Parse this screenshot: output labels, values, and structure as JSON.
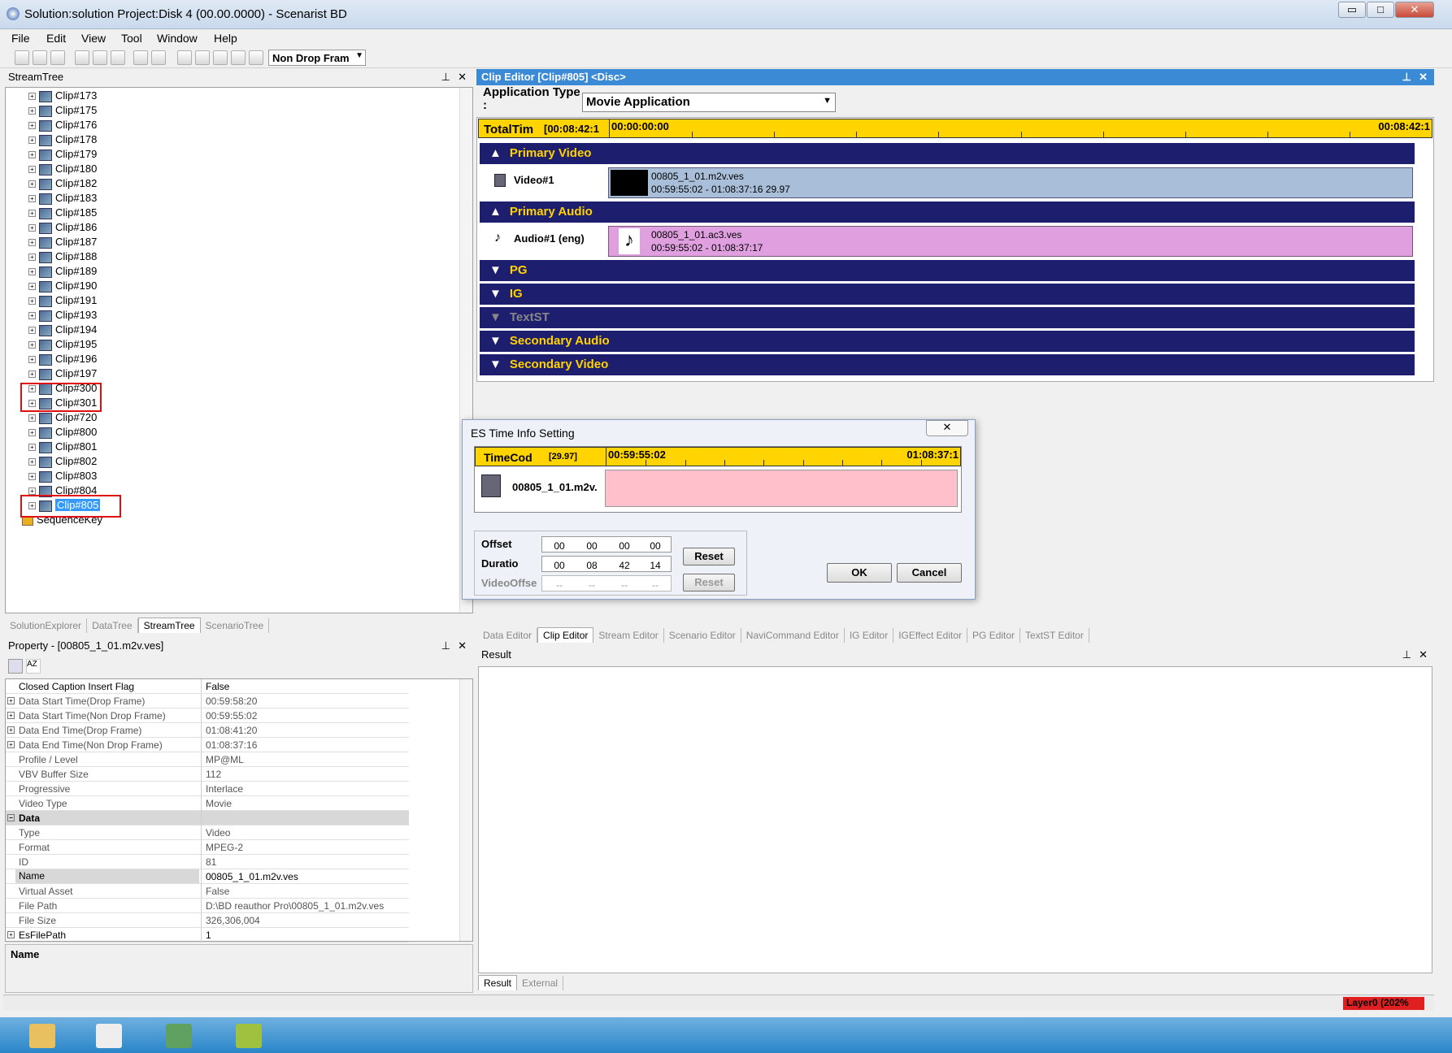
{
  "window": {
    "title": "Solution:solution  Project:Disk 4 (00.00.0000) - Scenarist BD",
    "min": "▭",
    "max": "□",
    "close": "✕"
  },
  "menu": [
    "File",
    "Edit",
    "View",
    "Tool",
    "Window",
    "Help"
  ],
  "toolbar": {
    "timecode_mode": "Non Drop Fram"
  },
  "stream_tree": {
    "header": "StreamTree",
    "items": [
      "Clip#173",
      "Clip#175",
      "Clip#176",
      "Clip#178",
      "Clip#179",
      "Clip#180",
      "Clip#182",
      "Clip#183",
      "Clip#185",
      "Clip#186",
      "Clip#187",
      "Clip#188",
      "Clip#189",
      "Clip#190",
      "Clip#191",
      "Clip#193",
      "Clip#194",
      "Clip#195",
      "Clip#196",
      "Clip#197",
      "Clip#300",
      "Clip#301",
      "Clip#720",
      "Clip#800",
      "Clip#801",
      "Clip#802",
      "Clip#803",
      "Clip#804",
      "Clip#805"
    ],
    "sequence_key": "SequenceKey",
    "tabs": [
      "SolutionExplorer",
      "DataTree",
      "StreamTree",
      "ScenarioTree"
    ]
  },
  "property": {
    "header": "Property - [00805_1_01.m2v.ves]",
    "rows": [
      {
        "k": "Closed Caption Insert Flag",
        "v": "False",
        "ex": ""
      },
      {
        "k": "Data Start Time(Drop Frame)",
        "v": "00:59:58:20",
        "ex": "+"
      },
      {
        "k": "Data Start Time(Non Drop Frame)",
        "v": "00:59:55:02",
        "ex": "+"
      },
      {
        "k": "Data End Time(Drop Frame)",
        "v": "01:08:41:20",
        "ex": "+"
      },
      {
        "k": "Data End Time(Non Drop Frame)",
        "v": "01:08:37:16",
        "ex": "+"
      },
      {
        "k": "Profile / Level",
        "v": "MP@ML",
        "ex": ""
      },
      {
        "k": "VBV Buffer Size",
        "v": "112",
        "ex": ""
      },
      {
        "k": "Progressive",
        "v": "Interlace",
        "ex": ""
      },
      {
        "k": "Video Type",
        "v": "Movie",
        "ex": ""
      },
      {
        "k": "Data",
        "v": "",
        "ex": "−"
      },
      {
        "k": "Type",
        "v": "Video",
        "ex": ""
      },
      {
        "k": "Format",
        "v": "MPEG-2",
        "ex": ""
      },
      {
        "k": "ID",
        "v": "81",
        "ex": ""
      },
      {
        "k": "Name",
        "v": "00805_1_01.m2v.ves",
        "ex": ""
      },
      {
        "k": "Virtual Asset",
        "v": "False",
        "ex": ""
      },
      {
        "k": "File Path",
        "v": "D:\\BD reauthor Pro\\00805_1_01.m2v.ves",
        "ex": ""
      },
      {
        "k": "File Size",
        "v": "326,306,004",
        "ex": ""
      },
      {
        "k": "EsFilePath",
        "v": "1",
        "ex": "+"
      }
    ],
    "desc_title": "Name"
  },
  "clip_editor": {
    "header": "Clip Editor [Clip#805] <Disc>",
    "app_type_label": "Application Type :",
    "app_type_value": "Movie Application",
    "total_label": "TotalTim",
    "total_value": "[00:08:42:1",
    "ruler_start": "00:00:00:00",
    "ruler_end": "00:08:42:1",
    "sections": [
      "Primary Video",
      "Primary Audio",
      "PG",
      "IG",
      "TextST",
      "Secondary Audio",
      "Secondary Video"
    ],
    "video": {
      "label": "Video#1",
      "file": "00805_1_01.m2v.ves",
      "range": "00:59:55:02 - 01:08:37:16  29.97"
    },
    "audio": {
      "label": "Audio#1 (eng)",
      "file": "00805_1_01.ac3.ves",
      "range": "00:59:55:02 - 01:08:37:17"
    }
  },
  "dialog": {
    "title": "ES Time Info Setting",
    "timecode_label": "TimeCod",
    "fps": "[29.97]",
    "start": "00:59:55:02",
    "end": "01:08:37:1",
    "clip_name": "00805_1_01.m2v.",
    "offset_label": "Offset",
    "offset": [
      "00",
      "00",
      "00",
      "00"
    ],
    "duration_label": "Duratio",
    "duration": [
      "00",
      "08",
      "42",
      "14"
    ],
    "videooffset_label": "VideoOffse",
    "videooffset": [
      "--",
      "--",
      "--",
      "--"
    ],
    "reset": "Reset",
    "ok": "OK",
    "cancel": "Cancel"
  },
  "editor_tabs": [
    "Data Editor",
    "Clip Editor",
    "Stream Editor",
    "Scenario Editor",
    "NaviCommand Editor",
    "IG Editor",
    "IGEffect Editor",
    "PG Editor",
    "TextST Editor"
  ],
  "result": {
    "header": "Result",
    "tabs": [
      "Result",
      "External"
    ]
  },
  "status": {
    "layer": "Layer0 (202%"
  }
}
